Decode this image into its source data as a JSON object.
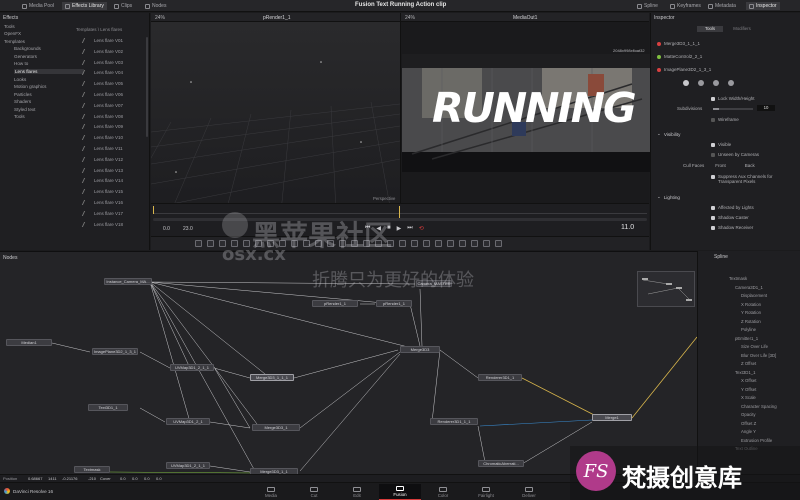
{
  "app": {
    "title": "Fusion Text Running Action clip",
    "name": "DaVinci Resolve 16"
  },
  "toolbar": {
    "media_pool": "Media Pool",
    "effects_library": "Effects Library",
    "clips": "Clips",
    "nodes": "Nodes",
    "spline": "Spline",
    "keyframes": "Keyframes",
    "metadata": "Metadata",
    "inspector": "Inspector"
  },
  "effects": {
    "title": "Effects",
    "tree": [
      "Tools",
      "OpenFX",
      "Templates",
      "Backgrounds",
      "Generators",
      "How to",
      "Lens flares",
      "Looks",
      "Motion graphics",
      "Particles",
      "Shaders",
      "Styled text",
      "Tools"
    ],
    "breadcrumb": "Templates \\ Lens flares",
    "lens_flares": [
      "Lens flare V01",
      "Lens flare V02",
      "Lens flare V03",
      "Lens flare V04",
      "Lens flare V05",
      "Lens flare V06",
      "Lens flare V07",
      "Lens flare V08",
      "Lens flare V09",
      "Lens flare V10",
      "Lens flare V11",
      "Lens flare V12",
      "Lens flare V13",
      "Lens flare V14",
      "Lens flare V15",
      "Lens flare V16",
      "Lens flare V17",
      "Lens flare V18"
    ]
  },
  "viewer_left": {
    "zoom": "24%",
    "name": "pRender1_1",
    "label": "Perspective"
  },
  "viewer_right": {
    "zoom": "24%",
    "name": "MediaOut1",
    "resolution": "2048x998xfloat32",
    "preview_text": "RUNNING"
  },
  "timeline": {
    "start": "0.0",
    "end_field": "23.0",
    "current": "11.0"
  },
  "inspector": {
    "title": "Inspector",
    "tabs": [
      "Tools",
      "Modifiers"
    ],
    "nodes": [
      {
        "name": "Merge3D3_1_1_1",
        "color": "#d94040"
      },
      {
        "name": "MatteControl2_2_1",
        "color": "#7fbf3f"
      },
      {
        "name": "ImagePlane3D2_1_3_1",
        "color": "#d94040"
      }
    ],
    "lock": "Lock Width/Height",
    "subdivisions_label": "Subdivisions",
    "subdivisions_value": "10",
    "wireframe": "Wireframe",
    "visibility_section": "Visibility",
    "visible": "Visible",
    "unseen_cameras": "Unseen by Cameras",
    "cull_faces": "Cull Faces",
    "front": "Front",
    "back": "Back",
    "suppress": "Suppress Aux Channels for Transparent Pixels",
    "lighting_section": "Lighting",
    "affected_lights": "Affected by Lights",
    "shadow_caster": "Shadow Caster",
    "shadow_receiver": "Shadow Receiver"
  },
  "nodes_panel": {
    "title": "Nodes",
    "nodes": {
      "instance_camera": "Instance_Camera_MA...",
      "camera_master": "Camera_MASTER",
      "prender_a": "pRender1_1",
      "prender_b": "pRender1_1",
      "median": "Median1",
      "imageplane": "ImagePlane3D2_1_3_1",
      "uvmap_a": "UVMap3D1_2_1_1",
      "merge_a": "Merge3D3_1_1_1",
      "merge_main": "Merge3D3",
      "renderer_a": "Renderer3D1_1",
      "text_a": "Text3D1_1",
      "uvmap_b": "UVMap3D1_2_1",
      "merge_b": "Merge3D3_1",
      "renderer_b": "Renderer3D1_1_1",
      "merge_final": "Merge1",
      "chromatic": "ChromaticAberrati...",
      "uvmap_c": "UVMap3D1_2_1_1",
      "merge_c": "Merge3D3_1_1",
      "textmask": "Textmask"
    }
  },
  "spline_panel": {
    "title": "Spline",
    "items": [
      "Textmask",
      "Camera3D1_1",
      "Displacement",
      "X Rotation",
      "Y Rotation",
      "Z Rotation",
      "Polyline",
      "pEmitter1_1",
      "Size Over Life",
      "Blur Over Life [3D]",
      "Z Offset",
      "Text3D1_1",
      "X Offset",
      "Y Offset",
      "X Scale",
      "Character Spacing",
      "Opacity",
      "Offset Z",
      "Angle Y",
      "Extrusion Profile",
      "Text Outline"
    ]
  },
  "status_bar": {
    "position_label": "Position",
    "x": "0.68667",
    "y": "1411",
    "z": "-0.21176",
    "w": "-210",
    "c": "Cover",
    "v1": "0.0",
    "v2": "0.0",
    "v3": "0.0",
    "v4": "0.0"
  },
  "pages": [
    "Media",
    "Cut",
    "Edit",
    "Fusion",
    "Color",
    "Fairlight",
    "Deliver"
  ],
  "watermark": {
    "brand": "osx.cx",
    "chinese_big": "黑苹果社区",
    "slogan": "折腾只为更好的体验",
    "corner_logo": "FS",
    "corner_text": "梵摄创意库"
  }
}
